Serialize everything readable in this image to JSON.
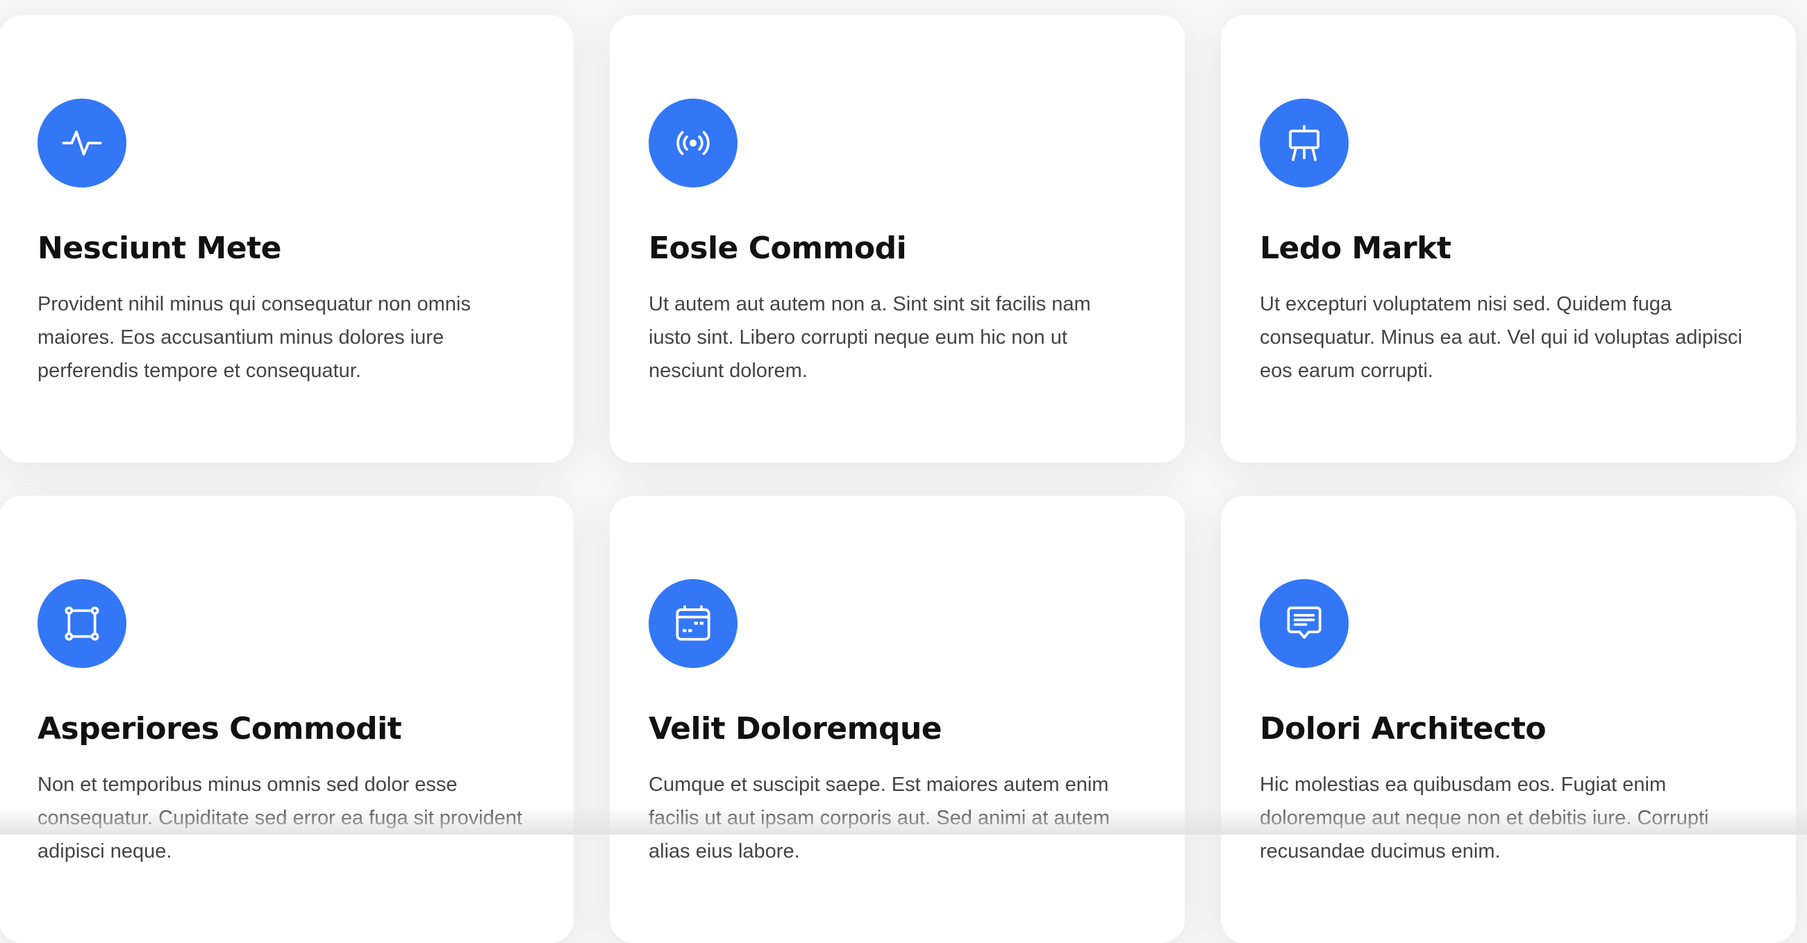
{
  "features": {
    "accent_color": "#3377f6",
    "cards": [
      {
        "icon": "activity-icon",
        "title": "Nesciunt Mete",
        "description": "Provident nihil minus qui consequatur non omnis maiores. Eos accusantium minus dolores iure perferendis tempore et consequatur."
      },
      {
        "icon": "broadcast-icon",
        "title": "Eosle Commodi",
        "description": "Ut autem aut autem non a. Sint sint sit facilis nam iusto sint. Libero corrupti neque eum hic non ut nesciunt dolorem."
      },
      {
        "icon": "easel-icon",
        "title": "Ledo Markt",
        "description": "Ut excepturi voluptatem nisi sed. Quidem fuga consequatur. Minus ea aut. Vel qui id voluptas adipisci eos earum corrupti."
      },
      {
        "icon": "bounding-box-icon",
        "title": "Asperiores Commodit",
        "description": "Non et temporibus minus omnis sed dolor esse consequatur. Cupiditate sed error ea fuga sit provident adipisci neque."
      },
      {
        "icon": "calendar-icon",
        "title": "Velit Doloremque",
        "description": "Cumque et suscipit saepe. Est maiores autem enim facilis ut aut ipsam corporis aut. Sed animi at autem alias eius labore."
      },
      {
        "icon": "chat-square-text-icon",
        "title": "Dolori Architecto",
        "description": "Hic molestias ea quibusdam eos. Fugiat enim doloremque aut neque non et debitis iure. Corrupti recusandae ducimus enim."
      }
    ]
  }
}
